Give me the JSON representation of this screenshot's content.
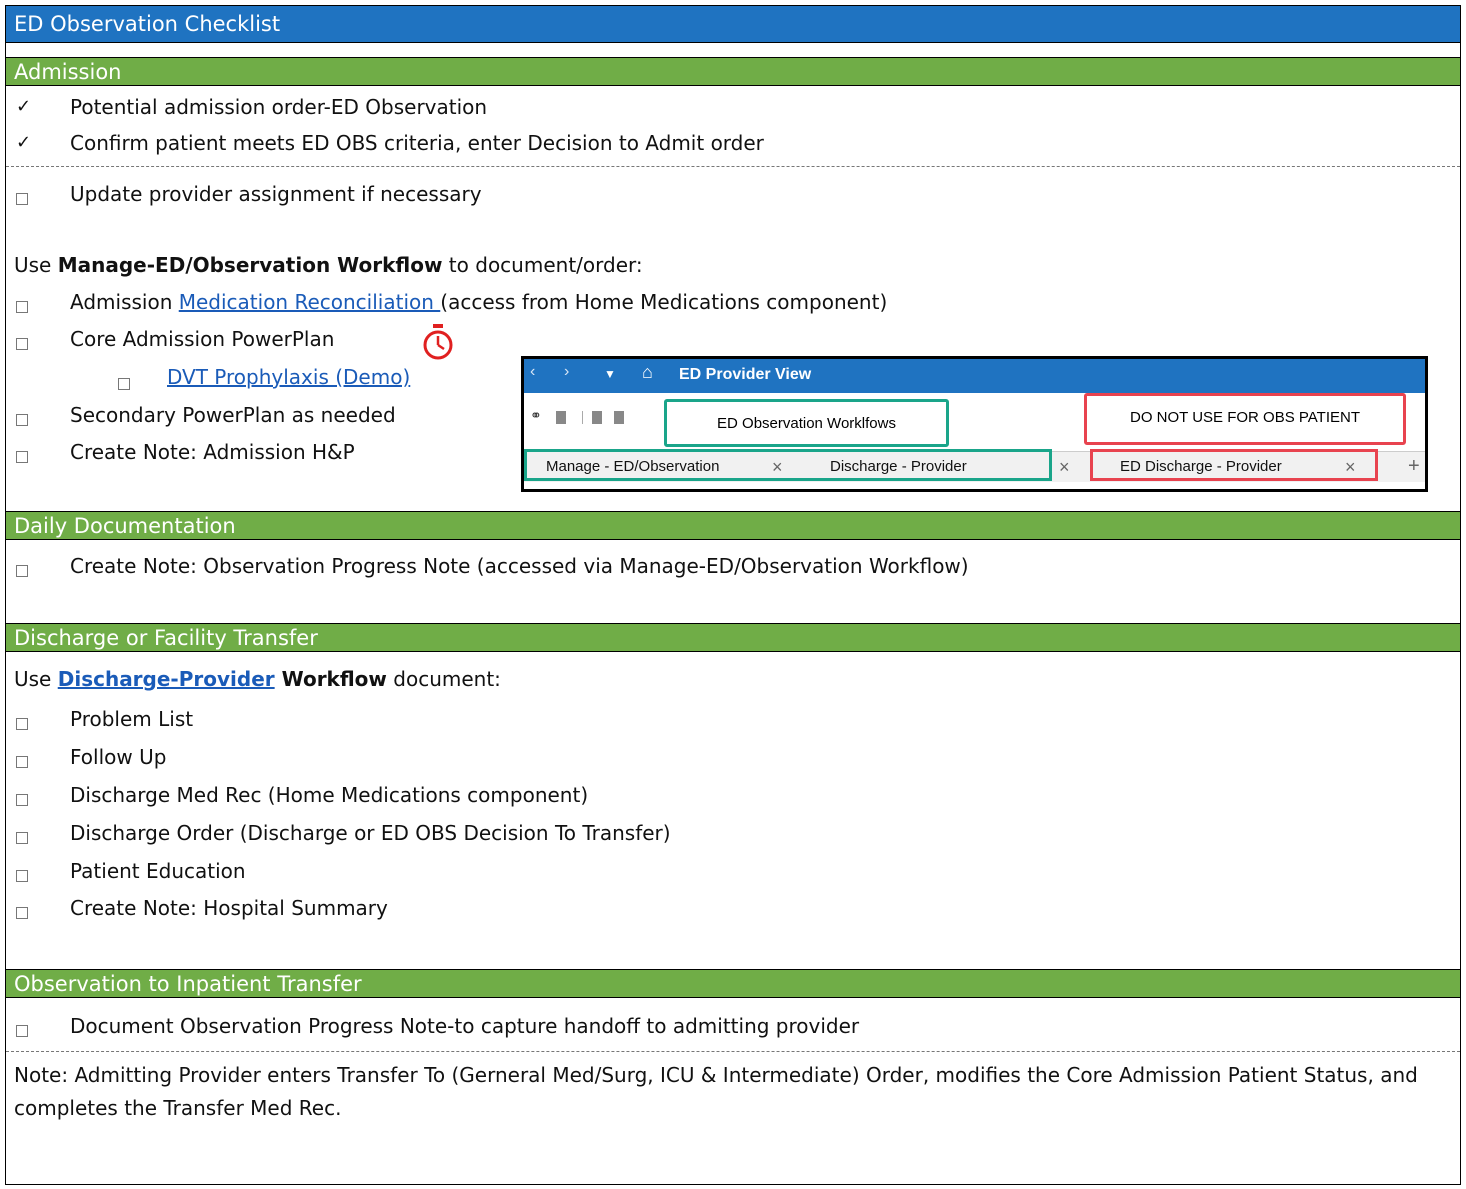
{
  "title": "ED Observation Checklist",
  "sections": {
    "admission": "Admission",
    "daily": "Daily Documentation",
    "discharge": "Discharge or Facility Transfer",
    "transfer": "Observation to Inpatient Transfer"
  },
  "admission": {
    "checked_items": [
      "Potential admission order-ED Observation",
      "Confirm patient meets ED OBS criteria, enter Decision to Admit order"
    ],
    "update_item": "Update provider assignment if necessary",
    "use_prefix": "Use ",
    "use_workflow": "Manage-ED/Observation Workflow",
    "use_suffix": " to document/order:",
    "med_rec_prefix": "Admission ",
    "med_rec_link": "Medication Reconciliation ",
    "med_rec_suffix": "(access from Home Medications component)",
    "core_powerplan": "Core Admission PowerPlan",
    "dvt_link": "DVT Prophylaxis (Demo)",
    "secondary_powerplan": "Secondary PowerPlan as needed",
    "create_note": "Create Note: Admission H&P"
  },
  "screenshot": {
    "title": "ED Provider View",
    "callout_green": "ED Observation Worklfows",
    "callout_red": "DO NOT USE FOR OBS PATIENT",
    "tab1": "Manage - ED/Observation",
    "tab2": "Discharge - Provider",
    "tab3": "ED Discharge - Provider"
  },
  "daily": {
    "item": "Create Note: Observation Progress Note (accessed via Manage-ED/Observation Workflow)"
  },
  "discharge": {
    "use_prefix": "Use ",
    "use_link": "Discharge-Provider",
    "use_bold": " Workflow",
    "use_suffix": " document:",
    "items": [
      "Problem List",
      "Follow Up",
      "Discharge Med Rec (Home Medications component)",
      "Discharge Order (Discharge or ED OBS Decision To Transfer)",
      "Patient Education",
      "Create Note: Hospital Summary"
    ]
  },
  "transfer": {
    "item": "Document Observation Progress Note-to capture handoff to admitting provider",
    "note": "Note: Admitting Provider enters Transfer To (Gerneral Med/Surg, ICU & Intermediate) Order, modifies the Core Admission Patient Status, and completes the Transfer Med Rec."
  }
}
